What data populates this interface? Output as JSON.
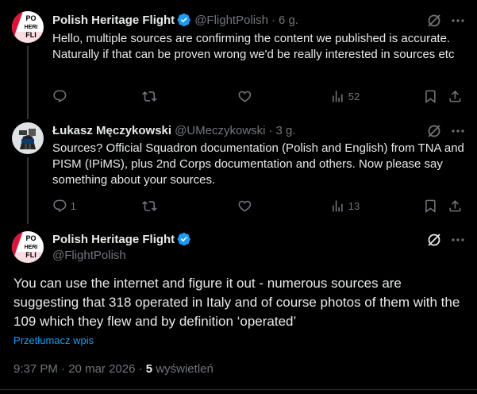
{
  "tweet1": {
    "name": "Polish Heritage Flight",
    "handle": "@FlightPolish",
    "time": "6 g.",
    "avatar_text": [
      "PO",
      "HERI",
      "FLI"
    ],
    "text": "Hello, multiple sources are confirming the content we published is accurate. Naturally if that can be proven wrong we'd be really interested in sources etc",
    "views": "52"
  },
  "tweet2": {
    "name": "Łukasz Męczykowski",
    "handle": "@UMeczykowski",
    "time": "3 g.",
    "text": "Sources? Official Squadron documentation (Polish and English) from TNA and PISM (IPiMS), plus 2nd Corps documentation and others. Now please say something about your sources.",
    "replies": "1",
    "views": "13"
  },
  "main_tweet": {
    "name": "Polish Heritage Flight",
    "handle": "@FlightPolish",
    "avatar_text": [
      "PO",
      "HERI",
      "FLI"
    ],
    "text": "You can use the internet and figure it out - numerous sources are suggesting that 318 operated in Italy and of course photos of them with the 109 which they flew and by definition ‘operated’",
    "translate_label": "Przetłumacz wpis",
    "time": "9:37 PM",
    "date": "20 mar 2026",
    "views_count": "5",
    "views_label": "wyświetleń"
  },
  "separator": "·",
  "colors": {
    "background": "#000000",
    "text": "#e7e9ea",
    "muted": "#71767b",
    "accent": "#1d9bf0",
    "thread_line": "#333639"
  },
  "icons": [
    "verified-badge-icon",
    "grok-icon",
    "more-icon",
    "reply-icon",
    "retweet-icon",
    "like-icon",
    "views-icon",
    "bookmark-icon",
    "share-icon"
  ]
}
